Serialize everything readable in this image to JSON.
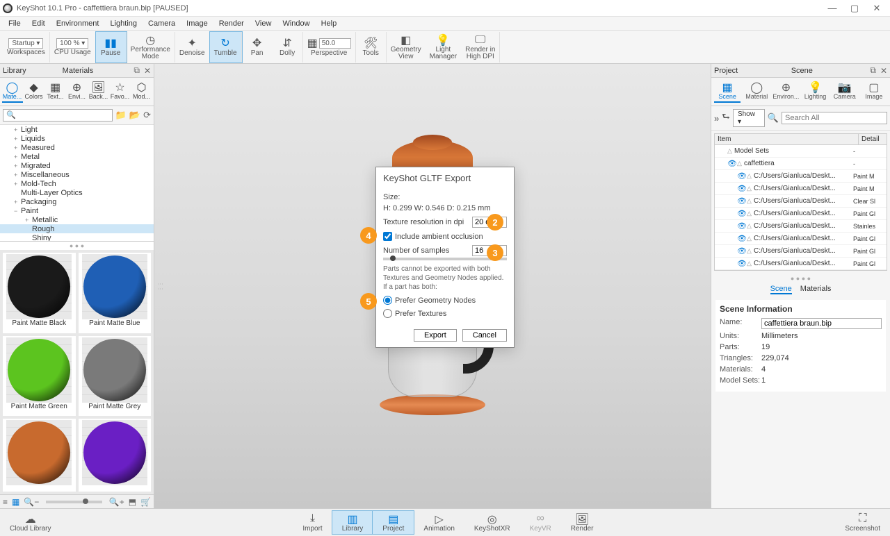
{
  "titlebar": {
    "text": "KeyShot 10.1 Pro  - caffettiera braun.bip [PAUSED]"
  },
  "win_controls": {
    "min": "—",
    "max": "▢",
    "close": "✕"
  },
  "menubar": [
    "File",
    "Edit",
    "Environment",
    "Lighting",
    "Camera",
    "Image",
    "Render",
    "View",
    "Window",
    "Help"
  ],
  "toolbar": {
    "startup_label": "Startup ▾",
    "workspaces": "Workspaces",
    "cpu_pct": "100 % ▾",
    "cpu_usage": "CPU Usage",
    "pause": "Pause",
    "perf_mode": "Performance\nMode",
    "denoise": "Denoise",
    "tumble": "Tumble",
    "pan": "Pan",
    "dolly": "Dolly",
    "view_num": "50.0",
    "perspective": "Perspective",
    "tools": "Tools",
    "geom_view": "Geometry\nView",
    "light_mgr": "Light\nManager",
    "high_dpi": "Render in\nHigh DPI"
  },
  "library": {
    "title_left": "Library",
    "title_tab": "Materials",
    "tabs": [
      "Mate...",
      "Colors",
      "Text...",
      "Envi...",
      "Back...",
      "Favo...",
      "Mod..."
    ],
    "search_placeholder": "🔍",
    "tree": [
      {
        "exp": "+",
        "label": "Light"
      },
      {
        "exp": "+",
        "label": "Liquids"
      },
      {
        "exp": "+",
        "label": "Measured"
      },
      {
        "exp": "+",
        "label": "Metal"
      },
      {
        "exp": "+",
        "label": "Migrated"
      },
      {
        "exp": "+",
        "label": "Miscellaneous"
      },
      {
        "exp": "+",
        "label": "Mold-Tech"
      },
      {
        "exp": "",
        "label": "Multi-Layer Optics"
      },
      {
        "exp": "+",
        "label": "Packaging"
      },
      {
        "exp": "−",
        "label": "Paint"
      },
      {
        "exp": "+",
        "label": "Metallic",
        "sub": true
      },
      {
        "exp": "",
        "label": "Rough",
        "sub": true,
        "sel": true
      },
      {
        "exp": "",
        "label": "Shiny",
        "sub": true
      }
    ],
    "swatches": [
      {
        "name": "Paint Matte Black",
        "color": "#1a1a1a"
      },
      {
        "name": "Paint Matte Blue",
        "color": "#1f5fb5"
      },
      {
        "name": "Paint Matte Green",
        "color": "#5cc41f"
      },
      {
        "name": "Paint Matte Grey",
        "color": "#7a7a7a"
      },
      {
        "name": "",
        "color": "#c86a2e"
      },
      {
        "name": "",
        "color": "#6a1fc4"
      }
    ]
  },
  "scene_panel": {
    "title_left": "Project",
    "title_tab": "Scene",
    "tabs": [
      "Scene",
      "Material",
      "Environ...",
      "Lighting",
      "Camera",
      "Image"
    ],
    "show_label": "Show ▾",
    "search_placeholder": "Search All",
    "table_headers": {
      "item": "Item",
      "detail": "Detail"
    },
    "rows": [
      {
        "indent": 0,
        "icon": "⊞",
        "label": "Model Sets",
        "mat": "-"
      },
      {
        "indent": 1,
        "icon": "👁",
        "label": "caffettiera",
        "mat": "-"
      },
      {
        "indent": 2,
        "icon": "👁",
        "label": "C:/Users/Gianluca/Deskt...",
        "mat": "Paint M"
      },
      {
        "indent": 2,
        "icon": "👁",
        "label": "C:/Users/Gianluca/Deskt...",
        "mat": "Paint M"
      },
      {
        "indent": 2,
        "icon": "👁",
        "label": "C:/Users/Gianluca/Deskt...",
        "mat": "Clear Sl"
      },
      {
        "indent": 2,
        "icon": "👁",
        "label": "C:/Users/Gianluca/Deskt...",
        "mat": "Paint Gl"
      },
      {
        "indent": 2,
        "icon": "👁",
        "label": "C:/Users/Gianluca/Deskt...",
        "mat": "Stainles"
      },
      {
        "indent": 2,
        "icon": "👁",
        "label": "C:/Users/Gianluca/Deskt...",
        "mat": "Paint Gl"
      },
      {
        "indent": 2,
        "icon": "👁",
        "label": "C:/Users/Gianluca/Deskt...",
        "mat": "Paint Gl"
      },
      {
        "indent": 2,
        "icon": "👁",
        "label": "C:/Users/Gianluca/Deskt...",
        "mat": "Paint Gl"
      }
    ],
    "subtabs": [
      "Scene",
      "Materials"
    ],
    "info_title": "Scene Information",
    "info": {
      "name_label": "Name:",
      "name_value": "caffettiera braun.bip",
      "units_label": "Units:",
      "units_value": "Millimeters",
      "parts_label": "Parts:",
      "parts_value": "19",
      "tri_label": "Triangles:",
      "tri_value": "229,074",
      "mat_label": "Materials:",
      "mat_value": "4",
      "ms_label": "Model Sets:",
      "ms_value": "1"
    }
  },
  "bottom": {
    "cloud": "Cloud Library",
    "import": "Import",
    "library": "Library",
    "project": "Project",
    "animation": "Animation",
    "xr": "KeyShotXR",
    "keyvr": "KeyVR",
    "render": "Render",
    "screenshot": "Screenshot"
  },
  "dialog": {
    "title": "KeyShot GLTF Export",
    "size_label": "Size:",
    "size_value": "H: 0.299 W: 0.546 D: 0.215   mm",
    "res_label": "Texture resolution in dpi",
    "res_value": "20 dpi",
    "ao_label": "Include ambient occlusion",
    "samples_label": "Number of samples",
    "samples_value": "16",
    "note": "Parts cannot be exported with both Textures and Geometry Nodes applied. If a part has both:",
    "r1": "Prefer Geometry Nodes",
    "r2": "Prefer Textures",
    "export": "Export",
    "cancel": "Cancel"
  },
  "annotations": {
    "a2": "2",
    "a3": "3",
    "a4": "4",
    "a5": "5"
  }
}
